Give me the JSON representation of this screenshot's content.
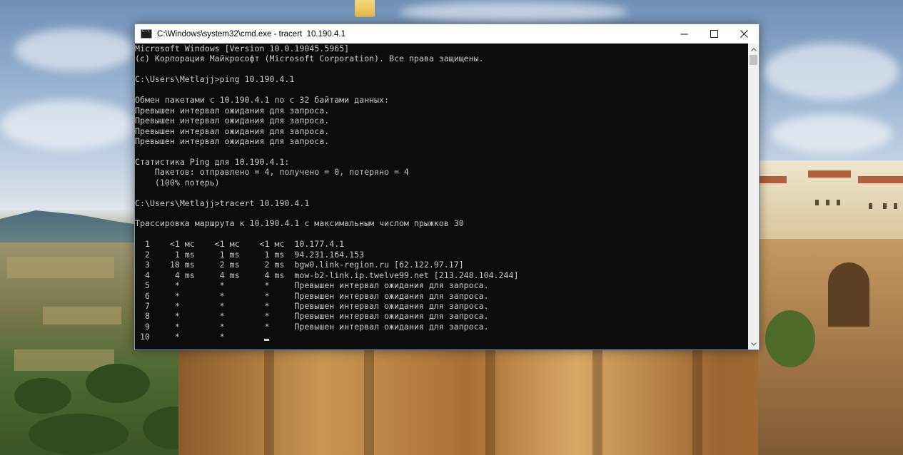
{
  "window": {
    "title": "C:\\Windows\\system32\\cmd.exe - tracert  10.190.4.1"
  },
  "icons": {
    "app": "cmd-icon",
    "minimize": "minimize-icon",
    "maximize": "maximize-icon",
    "close": "close-icon",
    "scroll_up": "chevron-up-icon",
    "scroll_down": "chevron-down-icon",
    "desktop_folder": "folder-icon"
  },
  "console": {
    "lines": [
      "Microsoft Windows [Version 10.0.19045.5965]",
      "(c) Корпорация Майкрософт (Microsoft Corporation). Все права защищены.",
      "",
      "C:\\Users\\Metlajj>ping 10.190.4.1",
      "",
      "Обмен пакетами с 10.190.4.1 по с 32 байтами данных:",
      "Превышен интервал ожидания для запроса.",
      "Превышен интервал ожидания для запроса.",
      "Превышен интервал ожидания для запроса.",
      "Превышен интервал ожидания для запроса.",
      "",
      "Статистика Ping для 10.190.4.1:",
      "    Пакетов: отправлено = 4, получено = 0, потеряно = 4",
      "    (100% потерь)",
      "",
      "C:\\Users\\Metlajj>tracert 10.190.4.1",
      "",
      "Трассировка маршрута к 10.190.4.1 с максимальным числом прыжков 30",
      "",
      "  1    <1 мс    <1 мс    <1 мс  10.177.4.1",
      "  2     1 ms     1 ms     1 ms  94.231.164.153",
      "  3    18 ms     2 ms     2 ms  bgw0.link-region.ru [62.122.97.17]",
      "  4     4 ms     4 ms     4 ms  mow-b2-link.ip.twelve99.net [213.248.104.244]",
      "  5     *        *        *     Превышен интервал ожидания для запроса.",
      "  6     *        *        *     Превышен интервал ожидания для запроса.",
      "  7     *        *        *     Превышен интервал ожидания для запроса.",
      "  8     *        *        *     Превышен интервал ожидания для запроса.",
      "  9     *        *        *     Превышен интервал ожидания для запроса.",
      " 10     *        *        "
    ]
  },
  "colors": {
    "console_bg": "#0c0c0c",
    "console_fg": "#c7c7c7",
    "titlebar_bg": "#ffffff",
    "scrollbar_bg": "#f0f0f0"
  }
}
